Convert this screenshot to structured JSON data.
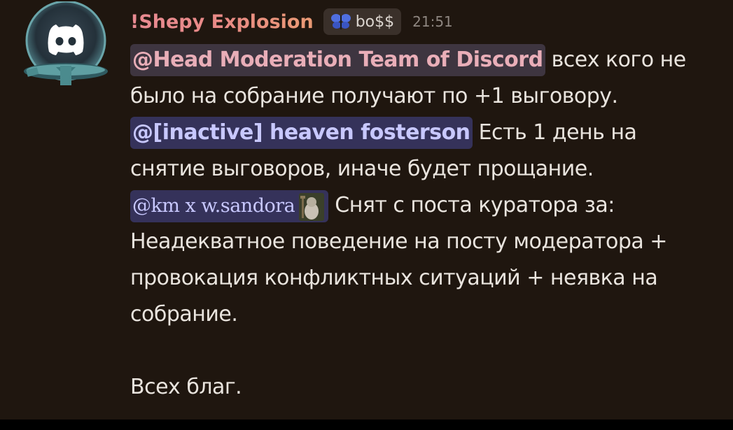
{
  "message": {
    "author": {
      "username": "!Shepy Explosion",
      "avatar_icon": "discord-logo-icon"
    },
    "role_tag": {
      "icon": "butterfly-icon",
      "label": "bo$$"
    },
    "timestamp": "21:51",
    "body": {
      "mention_role": "@Head Moderation Team of Discord",
      "line1_rest": " всех кого не",
      "line2": "было на собрание  получают по +1 выговору.",
      "mention_user1": "@[inactive] heaven fosterson",
      "line3_rest": " Есть 1 день на",
      "line4": "снятие выговоров, иначе будет прощание.",
      "mention_user2": "@km x w.sandora",
      "line5_rest": " Снят с поста куратора за:",
      "line6": "Неадекватное поведение на посту модератора +",
      "line7": "провокация конфликтных ситуаций + неявка на",
      "line8": "собрание.",
      "line9": "Всех благ."
    }
  }
}
